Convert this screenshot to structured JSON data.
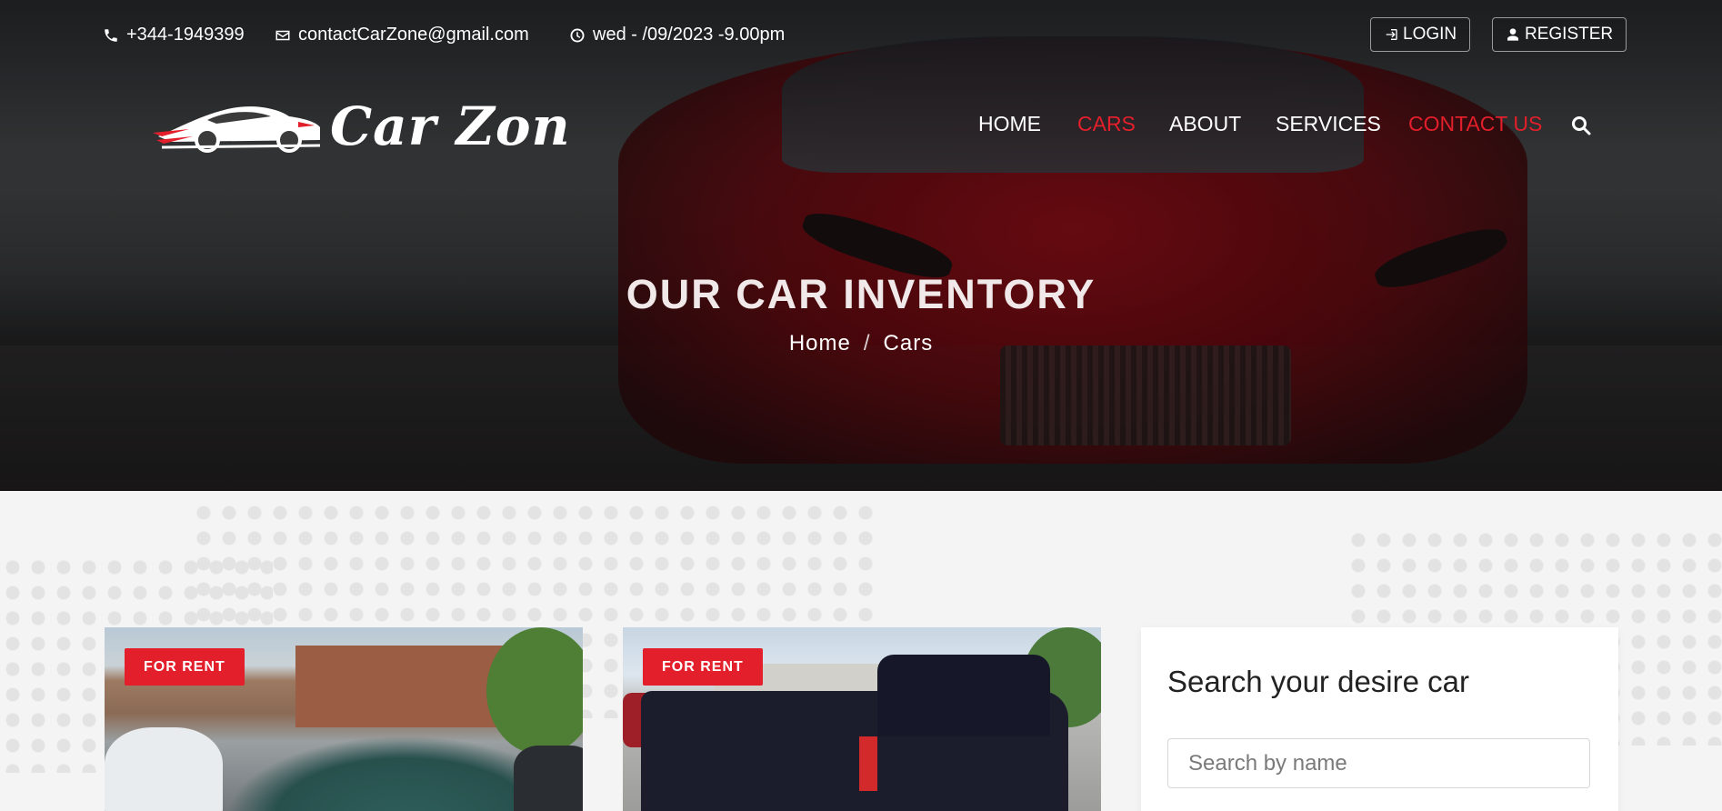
{
  "topbar": {
    "phone": "+344-1949399",
    "email": "contactCarZone@gmail.com",
    "hours": "wed - /09/2023 -9.00pm",
    "login_label": "LOGIN",
    "register_label": "REGISTER"
  },
  "brand": {
    "logo_text": "Car Zone",
    "accent_color": "#e21f2b"
  },
  "nav": {
    "items": [
      {
        "label": "HOME",
        "active": false
      },
      {
        "label": "CARS",
        "active": true
      },
      {
        "label": "ABOUT",
        "active": false
      },
      {
        "label": "SERVICES",
        "active": false
      },
      {
        "label": "CONTACT US",
        "active": true
      }
    ],
    "search_icon": "search-icon"
  },
  "hero": {
    "title": "OUR CAR INVENTORY",
    "breadcrumb": [
      "Home",
      "/",
      "Cars"
    ]
  },
  "listings": [
    {
      "badge": "FOR RENT"
    },
    {
      "badge": "FOR RENT"
    }
  ],
  "search": {
    "title": "Search your desire car",
    "placeholder": "Search by name",
    "value": ""
  }
}
